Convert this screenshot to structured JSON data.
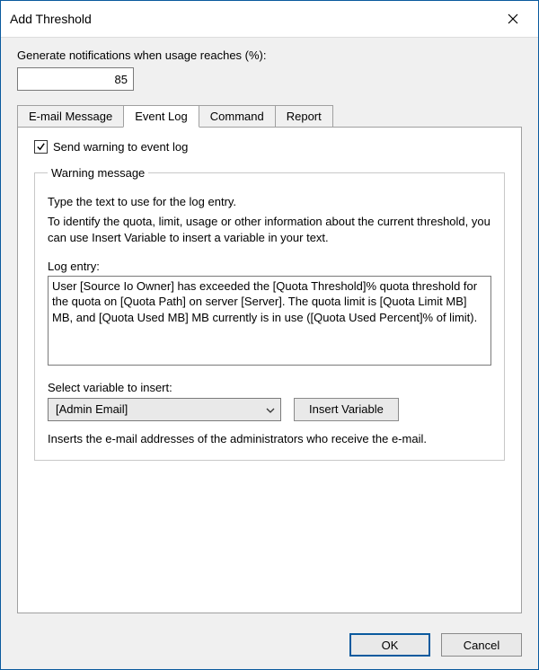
{
  "window": {
    "title": "Add Threshold"
  },
  "form": {
    "generate_label": "Generate notifications when usage reaches (%):",
    "usage_value": "85"
  },
  "tabs": [
    {
      "label": "E-mail Message"
    },
    {
      "label": "Event Log"
    },
    {
      "label": "Command"
    },
    {
      "label": "Report"
    }
  ],
  "eventlog": {
    "checkbox_label": "Send warning to event log",
    "group_legend": "Warning message",
    "instruction1": "Type the text to use for the log entry.",
    "instruction2": "To identify the quota, limit, usage or other information about the current threshold, you can use Insert Variable to insert a variable in your text.",
    "log_entry_label": "Log entry:",
    "log_entry_value": "User [Source Io Owner] has exceeded the [Quota Threshold]% quota threshold for the quota on [Quota Path] on server [Server]. The quota limit is [Quota Limit MB] MB, and [Quota Used MB] MB currently is in use ([Quota Used Percent]% of limit).",
    "select_variable_label": "Select variable to insert:",
    "selected_variable": "[Admin Email]",
    "insert_button": "Insert Variable",
    "variable_desc": "Inserts the e-mail addresses of the administrators who receive the e-mail."
  },
  "buttons": {
    "ok": "OK",
    "cancel": "Cancel"
  }
}
